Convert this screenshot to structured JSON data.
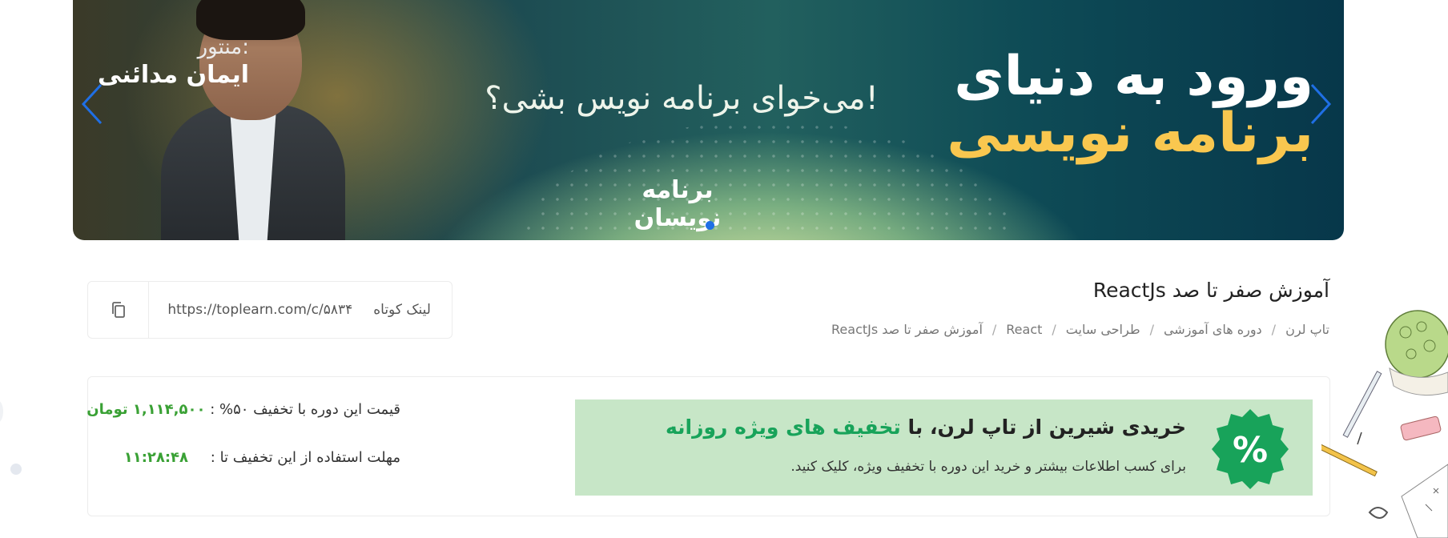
{
  "banner": {
    "mentor_label": "منتور:",
    "mentor_name": "ایمان مدائنی",
    "question": "می‌خوای برنامه نویس بشی؟!",
    "title_line1": "ورود به دنیای",
    "title_line2": "برنامه نویسی",
    "logo_text": "برنامه نویسان",
    "prev_icon": "chevron-left-icon",
    "next_icon": "chevron-right-icon",
    "dots_active": 1
  },
  "short_link": {
    "label": "لینک کوتاه",
    "url": "https://toplearn.com/c/۵۸۳۴",
    "copy_icon": "copy-icon"
  },
  "course": {
    "title": "آموزش صفر تا صد ReactJs"
  },
  "breadcrumb": {
    "items": [
      "تاپ لرن",
      "دوره های آموزشی",
      "طراحی سایت",
      "React",
      "آموزش صفر تا صد ReactJs"
    ],
    "separator": "/"
  },
  "promo": {
    "badge_icon": "percent-badge-icon",
    "headline_main": "خریدی شیرین از تاپ لرن، با",
    "headline_accent": "تخفیف های ویژه روزانه",
    "subtext": "برای کسب اطلاعات بیشتر و خرید این دوره با تخفیف ویژه، کلیک کنید.",
    "accent_color": "#18a35a",
    "background_color": "#c7e6c7"
  },
  "pricing": {
    "price_label": "قیمت این دوره با تخفیف ۵۰% :",
    "price_value": "۱,۱۱۴,۵۰۰ تومان",
    "deadline_label": "مهلت استفاده از این تخفیف تا :",
    "deadline_value": "۱۱:۲۸:۴۸",
    "value_color": "#3aa135"
  }
}
